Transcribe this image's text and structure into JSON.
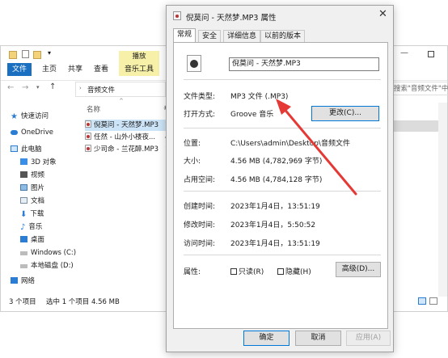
{
  "explorer": {
    "ribbon_highlight": "播放",
    "ribbon_tabs": [
      "文件",
      "主页",
      "共享",
      "查看",
      "音乐工具"
    ],
    "address": "音频文件",
    "search_placeholder": "搜索\"音频文件\"中搜索",
    "nav": [
      "快速访问",
      "OneDrive",
      "此电脑",
      "3D 对象",
      "视频",
      "图片",
      "文档",
      "下载",
      "音乐",
      "桌面",
      "Windows (C:)",
      "本地磁盘 (D:)",
      "网络"
    ],
    "column_name": "名称",
    "column_hash": "#",
    "files": [
      {
        "name": "倪莫问 - 天然梦.MP3",
        "num": "1"
      },
      {
        "name": "任然 - 山外小楼夜...",
        "num": "4"
      },
      {
        "name": "少司命 - 兰花醉.MP3",
        "num": "1"
      }
    ],
    "status_count": "3 个项目",
    "status_selected": "选中 1 个项目 4.56 MB"
  },
  "dialog": {
    "title": "倪莫问 - 天然梦.MP3 属性",
    "close": "✕",
    "tabs": [
      "常规",
      "安全",
      "详细信息",
      "以前的版本"
    ],
    "filename": "倪莫问 - 天然梦.MP3",
    "type_label": "文件类型:",
    "type_value": "MP3 文件 (.MP3)",
    "open_label": "打开方式:",
    "open_value": "Groove 音乐",
    "change_button": "更改(C)...",
    "location_label": "位置:",
    "location_value": "C:\\Users\\admin\\Desktop\\音频文件",
    "size_label": "大小:",
    "size_value": "4.56 MB (4,782,969 字节)",
    "disk_label": "占用空间:",
    "disk_value": "4.56 MB (4,784,128 字节)",
    "created_label": "创建时间:",
    "created_value": "2023年1月4日，13:51:19",
    "modified_label": "修改时间:",
    "modified_value": "2023年1月4日，5:50:52",
    "accessed_label": "访问时间:",
    "accessed_value": "2023年1月4日，13:51:19",
    "attr_label": "属性:",
    "readonly_label": "只读(R)",
    "hidden_label": "隐藏(H)",
    "advanced_button": "高级(D)...",
    "ok_button": "确定",
    "cancel_button": "取消",
    "apply_button": "应用(A)"
  },
  "colors": {
    "accent": "#0078d7",
    "arrow": "#e53935",
    "music_tab": "#f7f0a9"
  }
}
